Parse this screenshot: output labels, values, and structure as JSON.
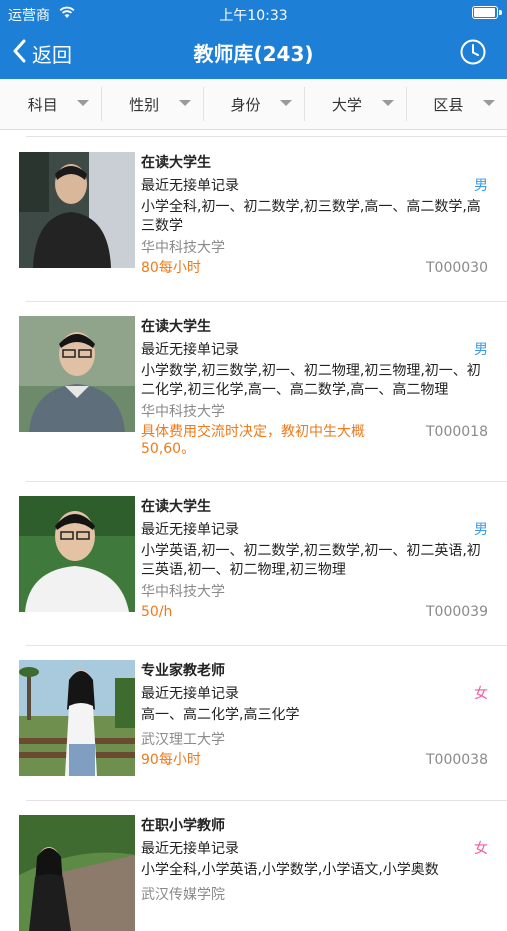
{
  "status": {
    "carrier": "运营商",
    "time": "上午10:33"
  },
  "nav": {
    "back_label": "返回",
    "title": "教师库(243)"
  },
  "filters": [
    "科目",
    "性别",
    "身份",
    "大学",
    "区县"
  ],
  "colors": {
    "brand": "#1d7fd6",
    "male": "#3a9be8",
    "female": "#ef5ba1",
    "price": "#ef7a1a"
  },
  "teachers": [
    {
      "title": "在读大学生",
      "record": "最近无接单记录",
      "gender": "男",
      "subjects": "小学全科,初一、初二数学,初三数学,高一、高二数学,高三数学",
      "school": "华中科技大学",
      "price": "80每小时",
      "id": "T000030"
    },
    {
      "title": "在读大学生",
      "record": "最近无接单记录",
      "gender": "男",
      "subjects": "小学数学,初三数学,初一、初二物理,初三物理,初一、初二化学,初三化学,高一、高二数学,高一、高二物理",
      "school": "华中科技大学",
      "price": "具体费用交流时决定，教初中生大概50,60。",
      "id": "T000018"
    },
    {
      "title": "在读大学生",
      "record": "最近无接单记录",
      "gender": "男",
      "subjects": "小学英语,初一、初二数学,初三数学,初一、初二英语,初三英语,初一、初二物理,初三物理",
      "school": "华中科技大学",
      "price": "50/h",
      "id": "T000039"
    },
    {
      "title": "专业家教老师",
      "record": "最近无接单记录",
      "gender": "女",
      "subjects": "高一、高二化学,高三化学",
      "school": "武汉理工大学",
      "price": "90每小时",
      "id": "T000038"
    },
    {
      "title": "在职小学教师",
      "record": "最近无接单记录",
      "gender": "女",
      "subjects": "小学全科,小学英语,小学数学,小学语文,小学奥数",
      "school": "武汉传媒学院",
      "price": "",
      "id": ""
    }
  ]
}
